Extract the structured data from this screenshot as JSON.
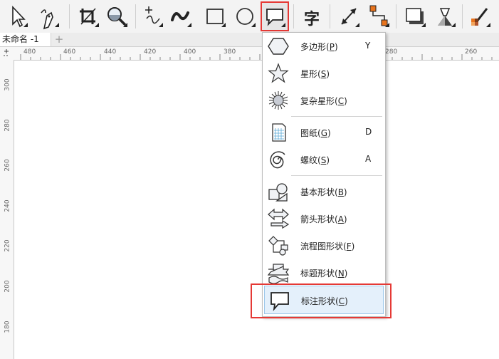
{
  "document": {
    "tab_title": "未命名 -1",
    "add_tab": "+"
  },
  "rulers": {
    "top": [
      "480",
      "460",
      "440",
      "420",
      "400",
      "380",
      "280",
      "260"
    ],
    "left": [
      "300",
      "280",
      "260",
      "240",
      "220",
      "200",
      "180"
    ]
  },
  "toolbar": {
    "tools": [
      "pick-tool",
      "freehand-tool",
      "crop-tool",
      "zoom-tool",
      "curve-tool",
      "artistic-media-tool",
      "rectangle-tool",
      "ellipse-tool",
      "callout-shape-tool",
      "text-tool",
      "dimension-tool",
      "connector-tool",
      "drop-shadow-tool",
      "transparency-tool",
      "eyedropper-tool"
    ],
    "text_tool_glyph": "字",
    "active_tool": "callout-shape-tool"
  },
  "menu": {
    "items": [
      {
        "label": "多边形(",
        "hotkey": "P",
        "tail": ")",
        "shortcut": "Y",
        "icon": "polygon-icon"
      },
      {
        "label": "星形(",
        "hotkey": "S",
        "tail": ")",
        "shortcut": "",
        "icon": "star-icon"
      },
      {
        "label": "复杂星形(",
        "hotkey": "C",
        "tail": ")",
        "shortcut": "",
        "icon": "complex-star-icon"
      },
      {
        "label": "图纸(",
        "hotkey": "G",
        "tail": ")",
        "shortcut": "D",
        "icon": "graph-paper-icon"
      },
      {
        "label": "螺纹(",
        "hotkey": "S",
        "tail": ")",
        "shortcut": "A",
        "icon": "spiral-icon"
      },
      {
        "label": "基本形状(",
        "hotkey": "B",
        "tail": ")",
        "shortcut": "",
        "icon": "basic-shapes-icon"
      },
      {
        "label": "箭头形状(",
        "hotkey": "A",
        "tail": ")",
        "shortcut": "",
        "icon": "arrow-shapes-icon"
      },
      {
        "label": "流程图形状(",
        "hotkey": "F",
        "tail": ")",
        "shortcut": "",
        "icon": "flowchart-shapes-icon"
      },
      {
        "label": "标题形状(",
        "hotkey": "N",
        "tail": ")",
        "shortcut": "",
        "icon": "banner-shapes-icon"
      },
      {
        "label": "标注形状(",
        "hotkey": "C",
        "tail": ")",
        "shortcut": "",
        "icon": "callout-shapes-icon"
      }
    ],
    "highlighted_index": 9
  },
  "colors": {
    "highlight_frame": "#e53935",
    "menu_highlight": "#e4f0fb"
  }
}
